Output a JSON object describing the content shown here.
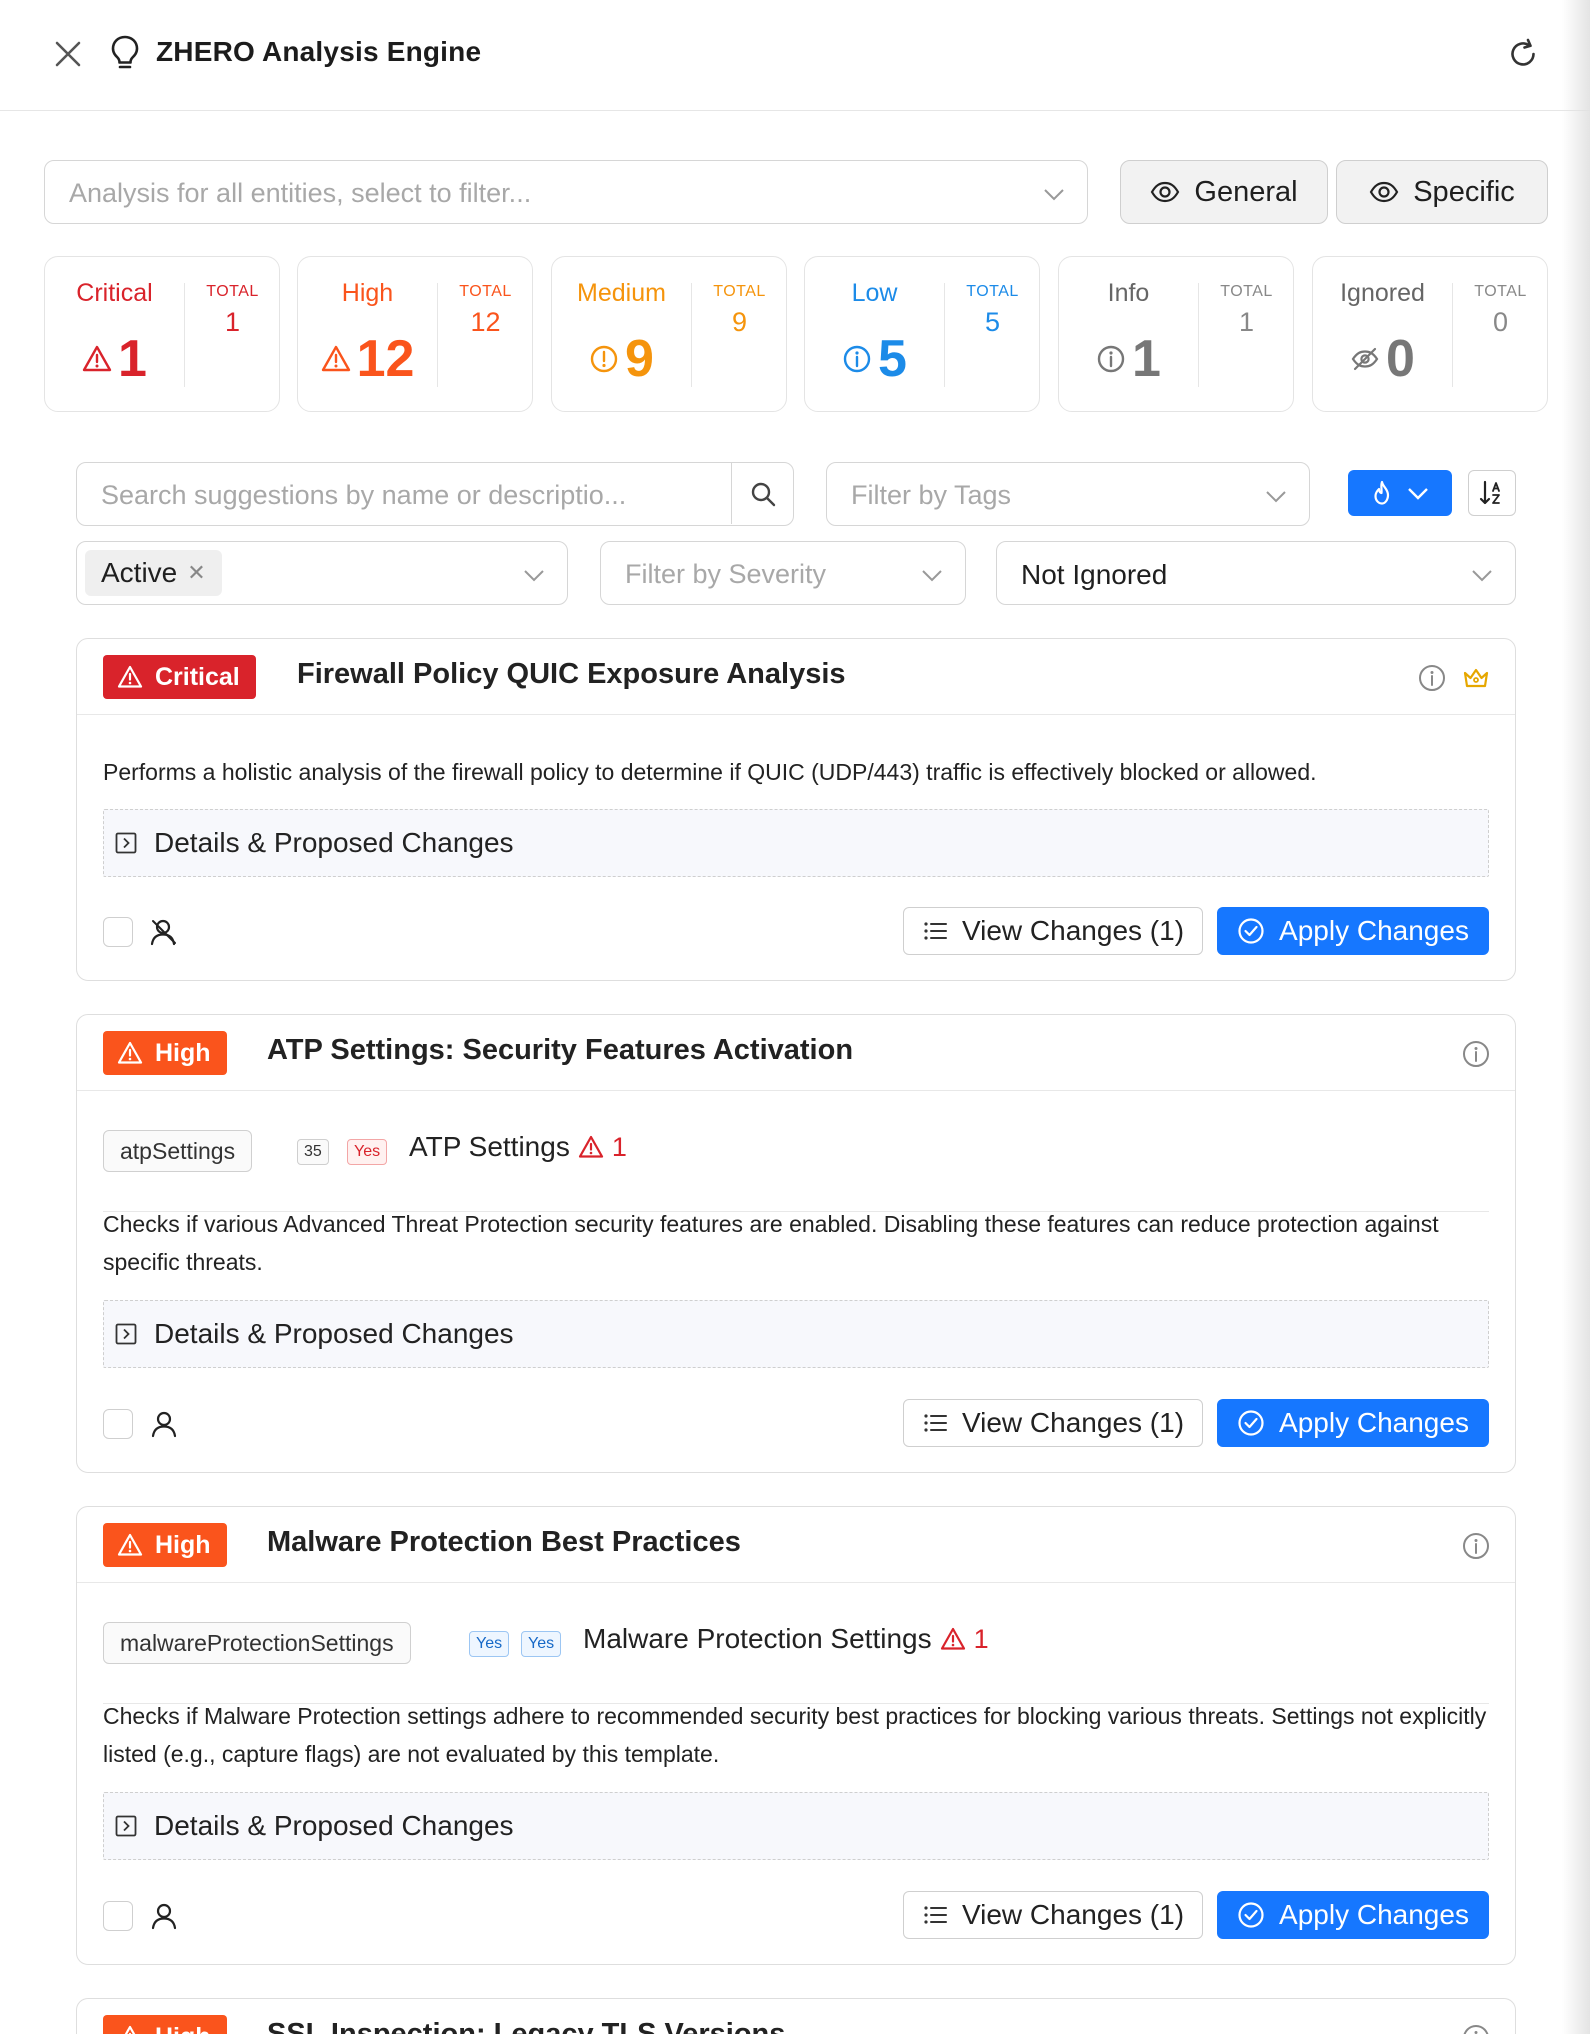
{
  "header": {
    "title": "ZHERO Analysis Engine",
    "icons": {
      "close": "close-icon",
      "bulb": "lightbulb-icon",
      "refresh": "refresh-icon"
    }
  },
  "entity_filter": {
    "placeholder": "Analysis for all entities, select to filter..."
  },
  "view_buttons": {
    "general": "General",
    "specific": "Specific"
  },
  "colors": {
    "critical": "#d9232b",
    "high": "#fa541c",
    "medium": "#f5940c",
    "low": "#1c8be8",
    "info": "#777777",
    "ignored": "#777777",
    "primary": "#1677ff"
  },
  "stats": [
    {
      "label": "Critical",
      "value": "1",
      "total_label": "TOTAL",
      "total": "1",
      "icon": "warning-triangle-icon"
    },
    {
      "label": "High",
      "value": "12",
      "total_label": "TOTAL",
      "total": "12",
      "icon": "warning-triangle-icon"
    },
    {
      "label": "Medium",
      "value": "9",
      "total_label": "TOTAL",
      "total": "9",
      "icon": "exclamation-circle-icon"
    },
    {
      "label": "Low",
      "value": "5",
      "total_label": "TOTAL",
      "total": "5",
      "icon": "info-circle-icon"
    },
    {
      "label": "Info",
      "value": "1",
      "total_label": "TOTAL",
      "total": "1",
      "icon": "info-circle-icon"
    },
    {
      "label": "Ignored",
      "value": "0",
      "total_label": "TOTAL",
      "total": "0",
      "icon": "eye-slash-icon"
    }
  ],
  "search": {
    "placeholder": "Search suggestions by name or descriptio..."
  },
  "tags_filter": {
    "placeholder": "Filter by Tags"
  },
  "status_filter": {
    "selected": "Active"
  },
  "severity_filter": {
    "placeholder": "Filter by Severity"
  },
  "ignored_filter": {
    "selected": "Not Ignored"
  },
  "cards": [
    {
      "severity": "Critical",
      "title": "Firewall Policy QUIC Exposure Analysis",
      "description": "Performs a holistic analysis of the firewall policy to determine if QUIC (UDP/443) traffic is effectively blocked or allowed.",
      "details_label": "Details & Proposed Changes",
      "view_label": "View Changes (1)",
      "apply_label": "Apply Changes"
    },
    {
      "severity": "High",
      "title": "ATP Settings: Security Features Activation",
      "entity_key": "atpSettings",
      "badge_1": "35",
      "badge_2": "Yes",
      "entity_name": "ATP Settings",
      "entity_count": "1",
      "description": "Checks if various Advanced Threat Protection security features are enabled. Disabling these features can reduce protection against specific threats.",
      "details_label": "Details & Proposed Changes",
      "view_label": "View Changes (1)",
      "apply_label": "Apply Changes"
    },
    {
      "severity": "High",
      "title": "Malware Protection Best Practices",
      "entity_key": "malwareProtectionSettings",
      "badge_1": "Yes",
      "badge_2": "Yes",
      "entity_name": "Malware Protection Settings",
      "entity_count": "1",
      "description": "Checks if Malware Protection settings adhere to recommended security best practices for blocking various threats. Settings not explicitly listed (e.g., capture flags) are not evaluated by this template.",
      "details_label": "Details & Proposed Changes",
      "view_label": "View Changes (1)",
      "apply_label": "Apply Changes"
    },
    {
      "severity": "High",
      "title": "SSL Inspection: Legacy TLS Versions"
    }
  ]
}
